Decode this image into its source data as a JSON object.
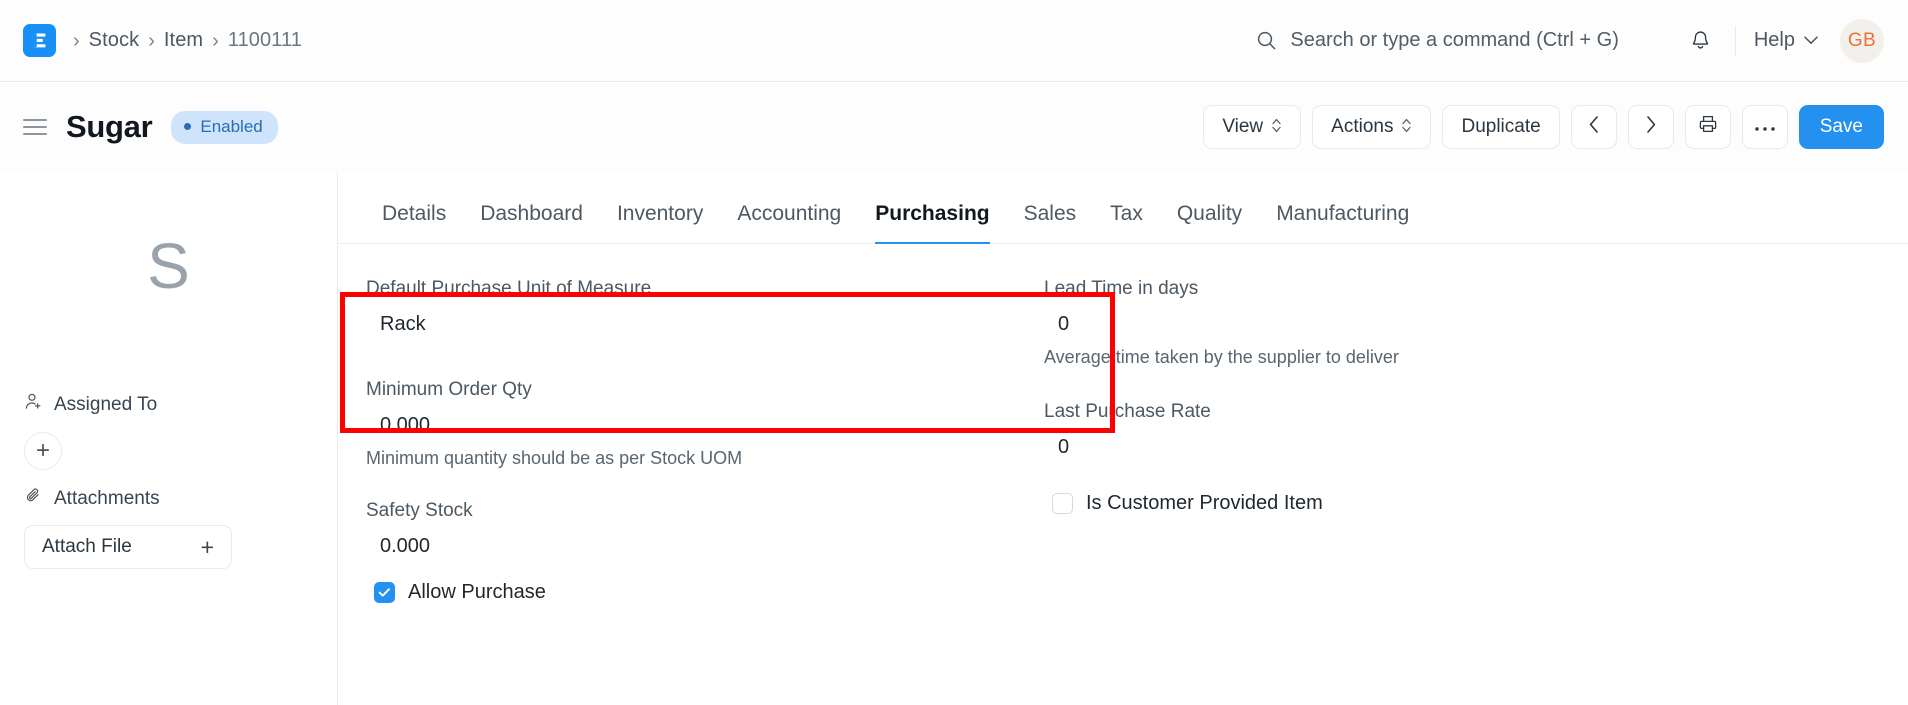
{
  "navbar": {
    "logo_icon": "erpnext-logo-icon",
    "breadcrumbs": [
      {
        "label": "Stock"
      },
      {
        "label": "Item"
      },
      {
        "label": "1100111"
      }
    ],
    "separator": "›",
    "search": {
      "icon": "search-icon",
      "placeholder": "Search or type a command (Ctrl + G)",
      "value": "Search or type a command (Ctrl + G)"
    },
    "notifications_icon": "bell-icon",
    "help_label": "Help",
    "help_chevron_icon": "chevron-down-icon",
    "avatar_initials": "GB"
  },
  "page_head": {
    "menu_icon": "hamburger-menu-icon",
    "title": "Sugar",
    "status_badge": "Enabled",
    "buttons": {
      "view": "View",
      "actions": "Actions",
      "duplicate": "Duplicate",
      "prev_icon": "chevron-left-icon",
      "next_icon": "chevron-right-icon",
      "print_icon": "printer-icon",
      "more_icon": "ellipsis-icon",
      "save": "Save"
    }
  },
  "sidebar": {
    "avatar_letter": "S",
    "assigned_to": {
      "icon": "user-plus-icon",
      "label": "Assigned To",
      "add_button": "+"
    },
    "attachments": {
      "icon": "paperclip-icon",
      "label": "Attachments",
      "attach_button": "Attach File",
      "attach_plus": "+"
    }
  },
  "tabs": [
    {
      "label": "Details",
      "active": false
    },
    {
      "label": "Dashboard",
      "active": false
    },
    {
      "label": "Inventory",
      "active": false
    },
    {
      "label": "Accounting",
      "active": false
    },
    {
      "label": "Purchasing",
      "active": true
    },
    {
      "label": "Sales",
      "active": false
    },
    {
      "label": "Tax",
      "active": false
    },
    {
      "label": "Quality",
      "active": false
    },
    {
      "label": "Manufacturing",
      "active": false
    }
  ],
  "form": {
    "left": {
      "default_purchase_uom": {
        "label": "Default Purchase Unit of Measure",
        "value": "Rack"
      },
      "minimum_order_qty": {
        "label": "Minimum Order Qty",
        "value": "0.000",
        "description": "Minimum quantity should be as per Stock UOM"
      },
      "safety_stock": {
        "label": "Safety Stock",
        "value": "0.000"
      },
      "allow_purchase": {
        "label": "Allow Purchase",
        "checked": true
      }
    },
    "right": {
      "lead_time_in_days": {
        "label": "Lead Time in days",
        "value": "0",
        "description": "Average time taken by the supplier to deliver"
      },
      "last_purchase_rate": {
        "label": "Last Purchase Rate",
        "value": "0"
      },
      "is_customer_provided_item": {
        "label": "Is Customer Provided Item",
        "checked": false
      }
    }
  },
  "annotation": {
    "highlight_color": "#ff0000",
    "highlight_target": "default-purchase-unit-of-measure-field"
  }
}
